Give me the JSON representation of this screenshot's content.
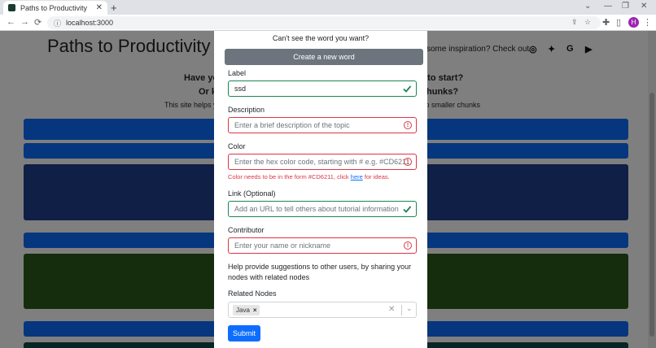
{
  "browser": {
    "tab_title": "Paths to Productivity",
    "url": "localhost:3000",
    "profile_initial": "H"
  },
  "site": {
    "title": "Paths to Productivity",
    "inspiration_text": "some inspiration? Check out",
    "social_icons": [
      "instagram-icon",
      "twitter-icon",
      "google-icon",
      "youtube-icon"
    ],
    "hero_left_1": "Have yo",
    "hero_right_1": "e to start?",
    "hero_left_2": "Or k",
    "hero_right_2": "hunks?",
    "hero_left_3": "This site helps y",
    "hero_right_3": "nto smaller chunks",
    "band_colors": [
      "#0d6efd",
      "#0d6efd",
      "#1f3f8a",
      "#0d6efd",
      "#2b5a1a",
      "#0d6efd",
      "#0e4a4a"
    ]
  },
  "modal": {
    "cant_see": "Can't see the word you want?",
    "create_button": "Create a new word",
    "label": {
      "label": "Label",
      "value": "ssd"
    },
    "description": {
      "label": "Description",
      "placeholder": "Enter a brief description of the topic"
    },
    "color": {
      "label": "Color",
      "placeholder": "Enter the hex color code, starting with # e.g. #CD6211",
      "error_prefix": "Color needs to be in the form #CD6211, click ",
      "error_link": "here",
      "error_suffix": " for ideas."
    },
    "link": {
      "label": "Link (Optional)",
      "placeholder": "Add an URL to tell others about tutorial information"
    },
    "contributor": {
      "label": "Contributor",
      "placeholder": "Enter your name or nickname"
    },
    "help_text": "Help provide suggestions to other users, by sharing your nodes with related nodes",
    "related_nodes": {
      "label": "Related Nodes",
      "selected": [
        "Java"
      ]
    },
    "submit_button": "Submit"
  },
  "colors": {
    "valid": "#198754",
    "invalid": "#dc3545",
    "primary": "#0d6efd",
    "secondary": "#6c757d"
  }
}
